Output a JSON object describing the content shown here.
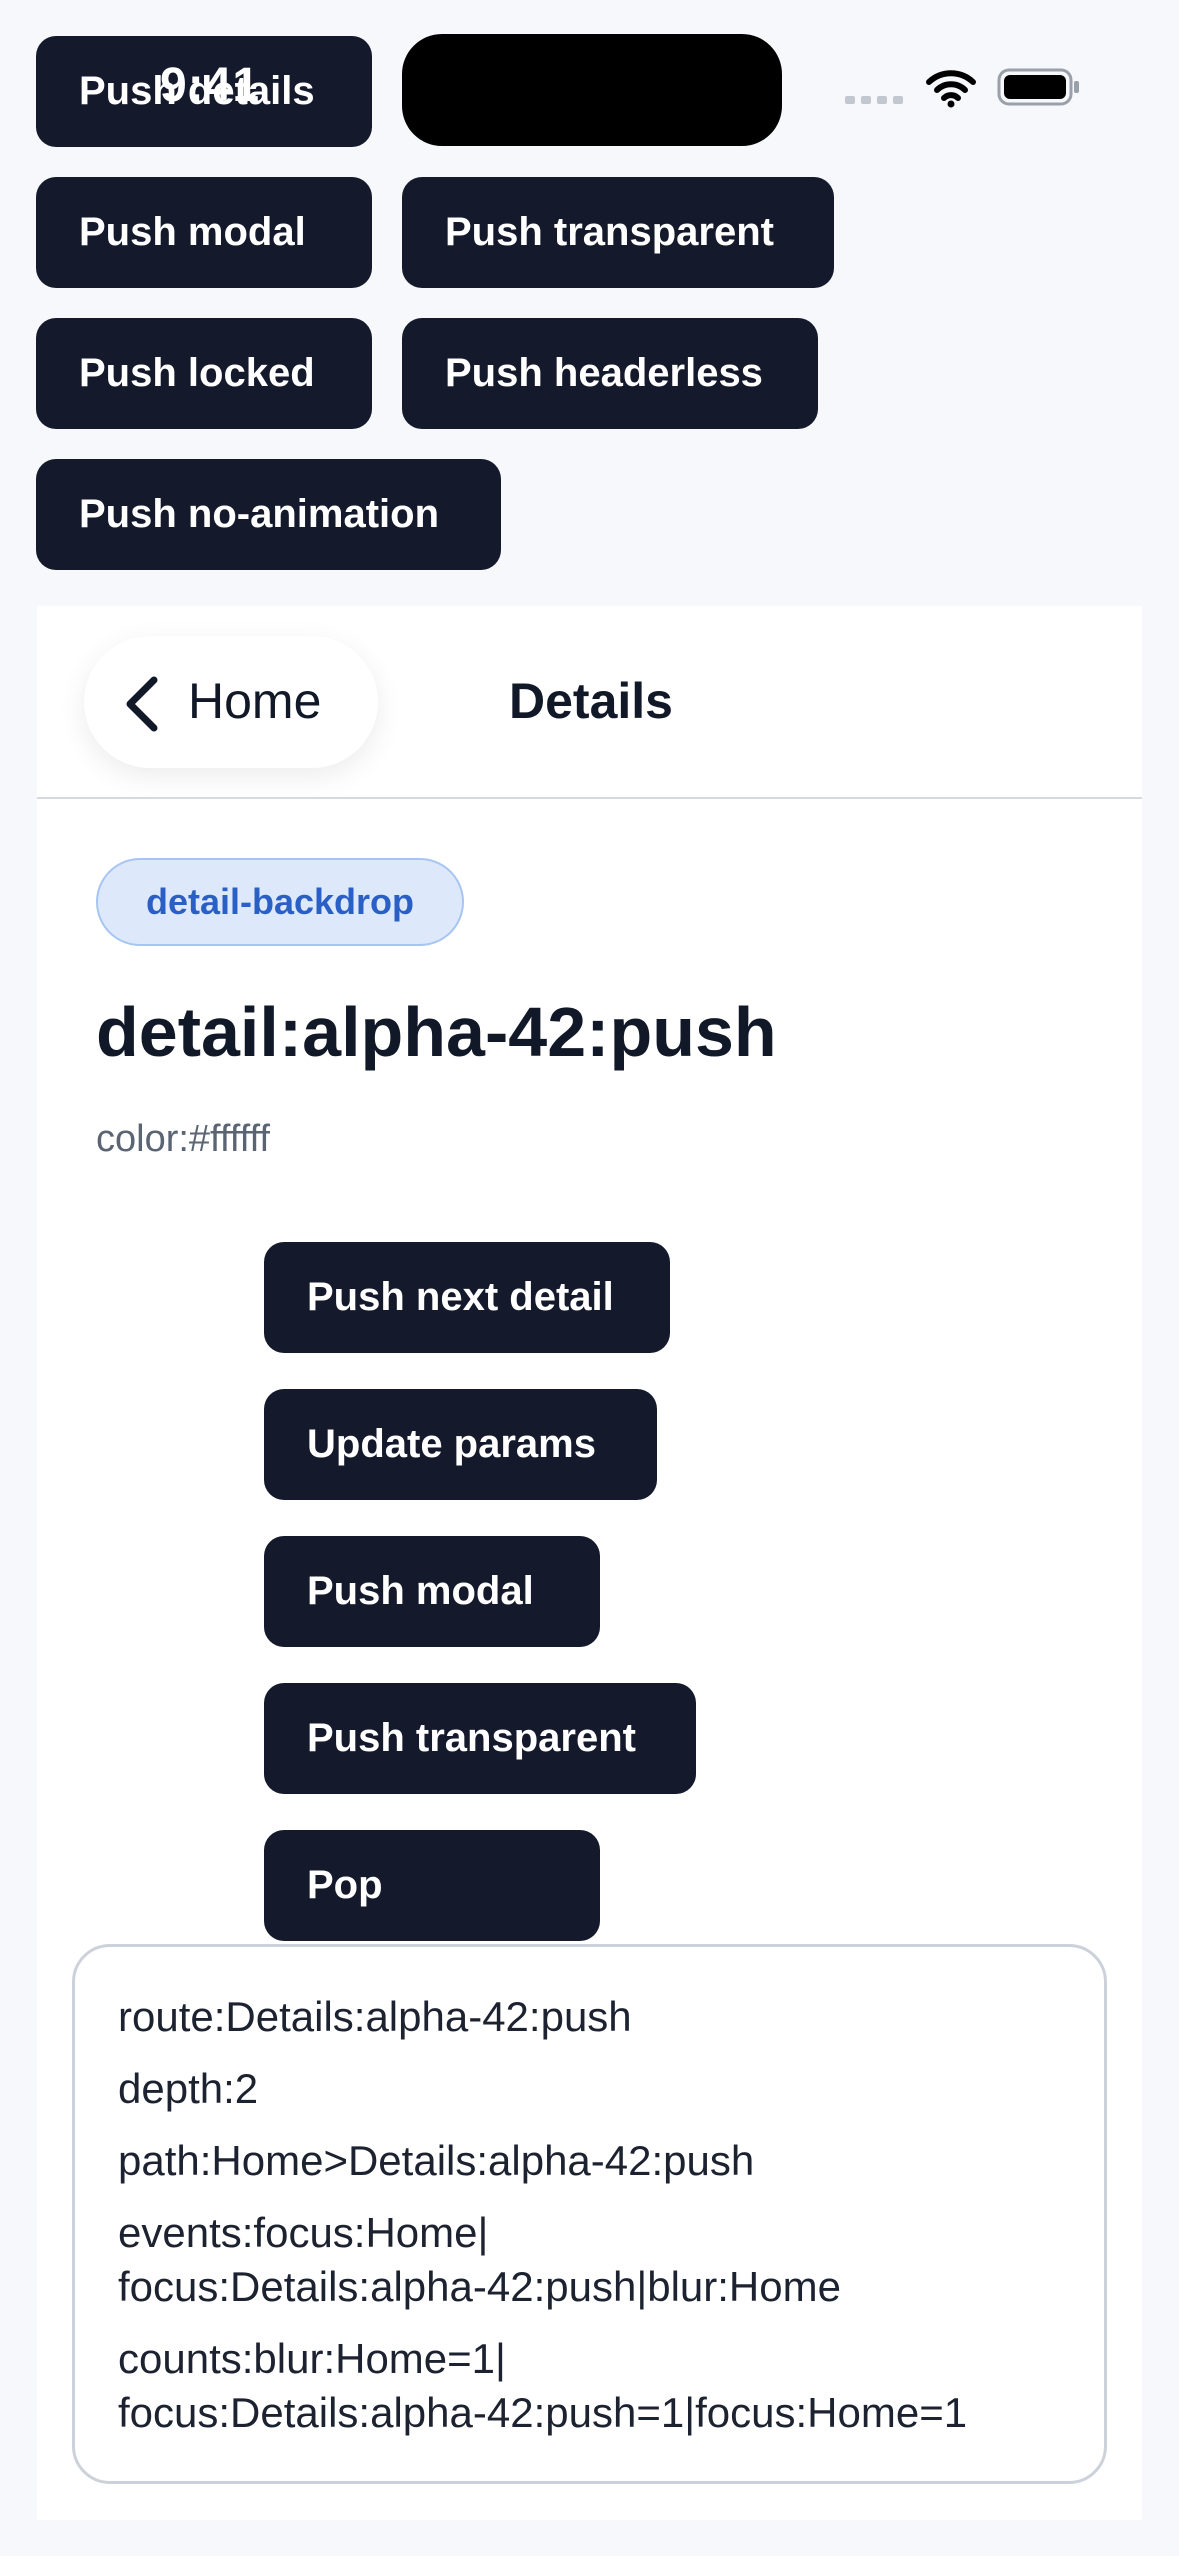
{
  "status_bar": {
    "time": "9:41"
  },
  "top_actions": {
    "push_details": "Push details",
    "push_modal": "Push modal",
    "push_transparent": "Push transparent",
    "push_locked": "Push locked",
    "push_headerless": "Push headerless",
    "push_no_animation": "Push no-animation"
  },
  "nav": {
    "back_label": "Home",
    "title": "Details"
  },
  "detail": {
    "tag": "detail-backdrop",
    "heading": "detail:alpha-42:push",
    "color_text": "color:#ffffff",
    "actions": {
      "push_next_detail": "Push next detail",
      "update_params": "Update params",
      "push_modal": "Push modal",
      "push_transparent": "Push transparent",
      "pop": "Pop"
    }
  },
  "info": {
    "route": "route:Details:alpha-42:push",
    "depth": "depth:2",
    "path": "path:Home>Details:alpha-42:push",
    "events_line1": "events:focus:Home|",
    "events_line2": "focus:Details:alpha-42:push|blur:Home",
    "counts_line1": "counts:blur:Home=1|",
    "counts_line2": "focus:Details:alpha-42:push=1|focus:Home=1"
  },
  "icons": {
    "back": "chevron-left-icon",
    "wifi": "wifi-icon",
    "battery": "battery-icon",
    "signal": "cellular-signal-icon"
  },
  "colors": {
    "button_bg": "#141a2b",
    "tag_bg": "#dde9fb",
    "tag_text": "#2a5fc6",
    "page_bg": "#f7f8fb"
  }
}
